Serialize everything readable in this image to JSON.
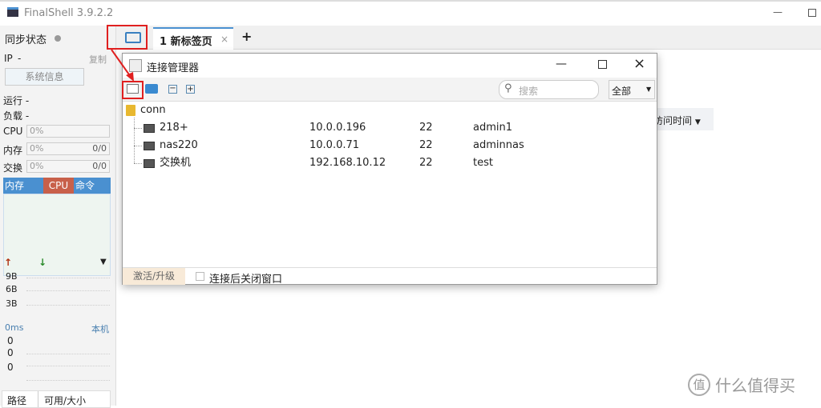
{
  "app": {
    "title": "FinalShell 3.9.2.2"
  },
  "sidebar": {
    "sync_label": "同步状态",
    "ip_label": "IP",
    "ip_value": "-",
    "copy": "复制",
    "sysinfo_button": "系统信息",
    "run_label": "运行 -",
    "load_label": "负载 -",
    "cpu_label": "CPU",
    "cpu_value": "0%",
    "mem_label": "内存",
    "mem_value": "0%",
    "mem_ratio": "0/0",
    "swap_label": "交换",
    "swap_value": "0%",
    "swap_ratio": "0/0",
    "tabs": [
      "内存",
      "CPU",
      "命令"
    ],
    "net_ticks": [
      "9B",
      "6B",
      "3B"
    ],
    "ping_label": "0ms",
    "ping_host": "本机",
    "ping_ticks": [
      "0",
      "0",
      "0"
    ],
    "disk_headers": [
      "路径",
      "可用/大小"
    ]
  },
  "tabs": {
    "items": [
      {
        "label": "1 新标签页"
      }
    ],
    "add": "+"
  },
  "main": {
    "sort_dropdown": "访问时间"
  },
  "dialog": {
    "title": "连接管理器",
    "search_placeholder": "搜索",
    "filter": "全部",
    "folder": "conn",
    "connections": [
      {
        "name": "218+",
        "host": "10.0.0.196",
        "port": "22",
        "user": "admin1"
      },
      {
        "name": "nas220",
        "host": "10.0.0.71",
        "port": "22",
        "user": "adminnas"
      },
      {
        "name": "交换机",
        "host": "192.168.10.12",
        "port": "22",
        "user": "test"
      }
    ],
    "activate": "激活/升级",
    "close_after_connect": "连接后关闭窗口"
  },
  "watermark": "什么值得买",
  "colors": {
    "cpu_tab": "#c8604a",
    "tab_blue": "#4a90d0",
    "highlight": "#e02020"
  }
}
